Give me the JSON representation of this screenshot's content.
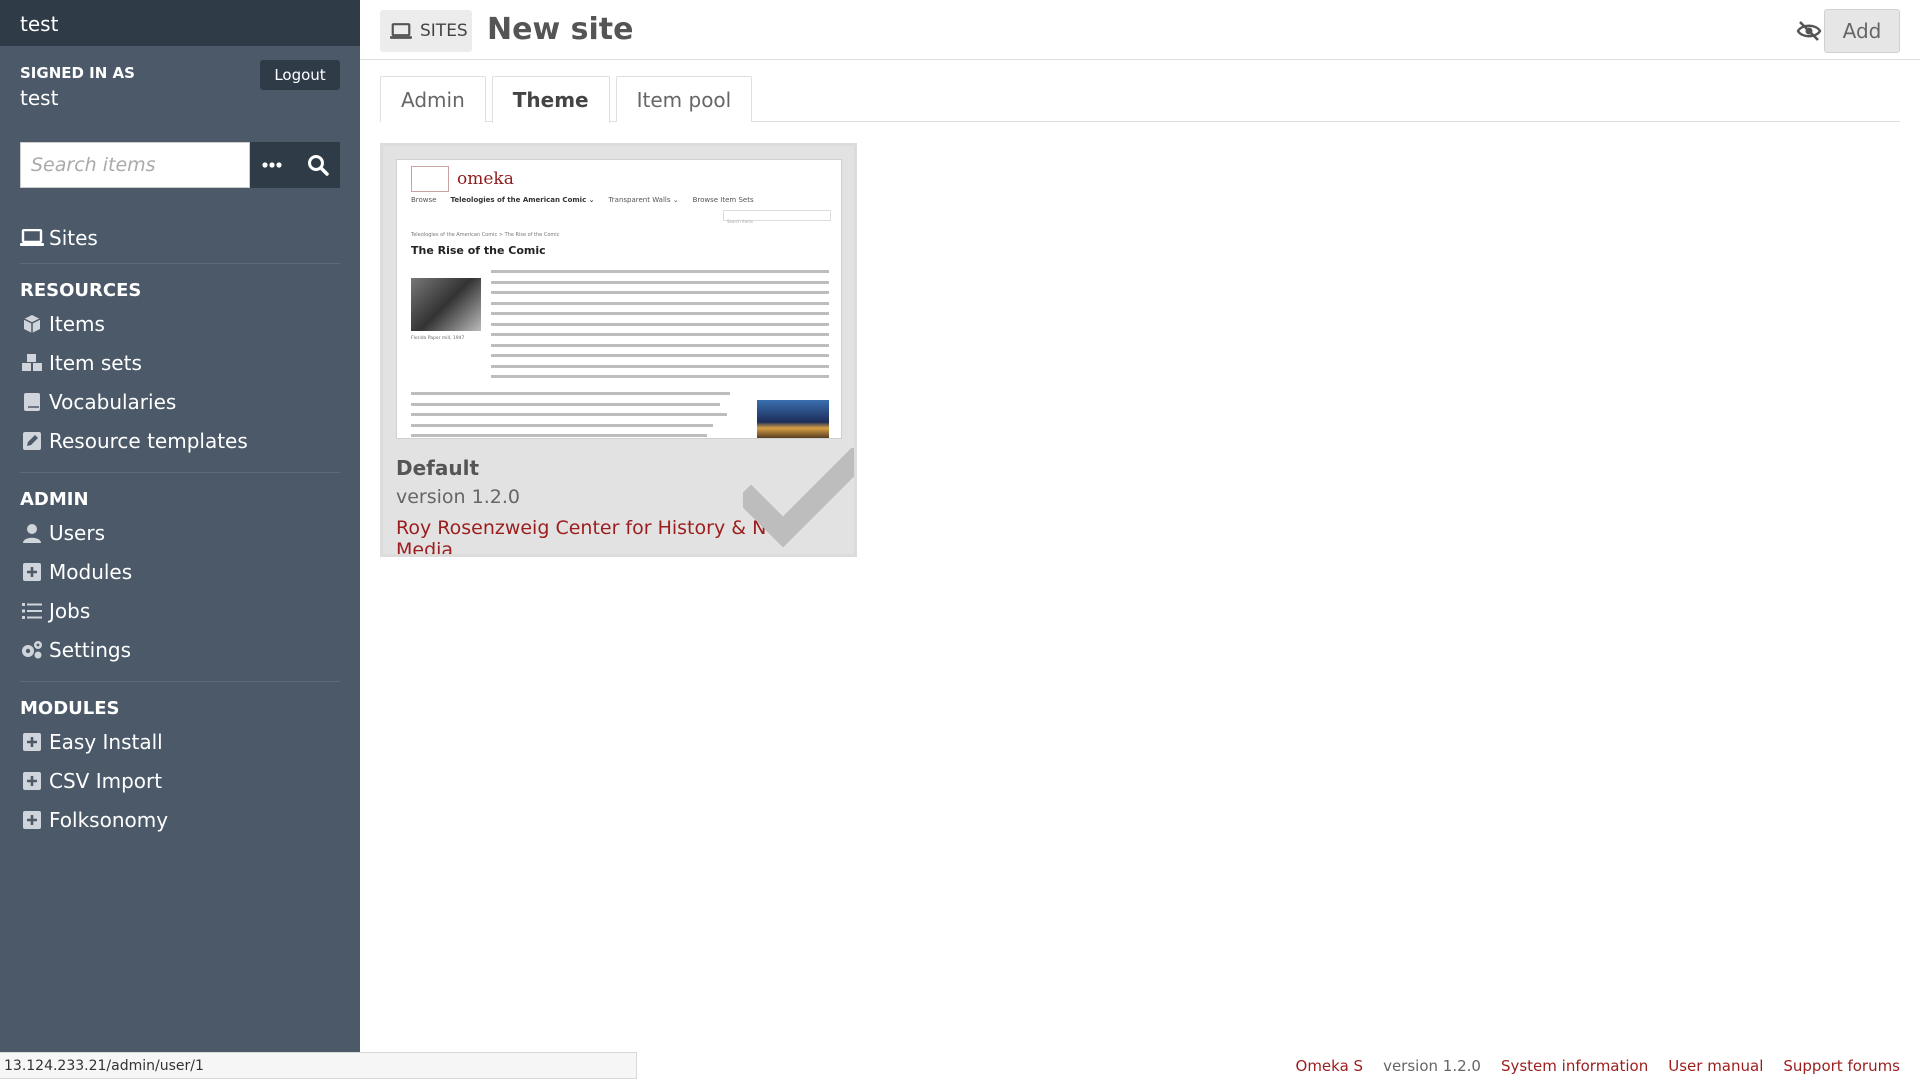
{
  "sidebar": {
    "install_name": "test",
    "signed_in_label": "Signed in as",
    "username": "test",
    "logout_label": "Logout",
    "search_placeholder": "Search items",
    "sites_label": "Sites",
    "resources_heading": "Resources",
    "resources": [
      {
        "label": "Items",
        "icon": "cube-icon"
      },
      {
        "label": "Item sets",
        "icon": "cubes-icon"
      },
      {
        "label": "Vocabularies",
        "icon": "book-icon"
      },
      {
        "label": "Resource templates",
        "icon": "edit-icon"
      }
    ],
    "admin_heading": "Admin",
    "admin": [
      {
        "label": "Users",
        "icon": "user-icon"
      },
      {
        "label": "Modules",
        "icon": "plus-square-icon"
      },
      {
        "label": "Jobs",
        "icon": "list-icon"
      },
      {
        "label": "Settings",
        "icon": "cogs-icon"
      }
    ],
    "modules_heading": "Modules",
    "modules": [
      {
        "label": "Easy Install",
        "icon": "plus-square-icon"
      },
      {
        "label": "CSV Import",
        "icon": "plus-square-icon"
      },
      {
        "label": "Folksonomy",
        "icon": "plus-square-icon"
      }
    ]
  },
  "header": {
    "section_label": "SITES",
    "title": "New site",
    "add_label": "Add"
  },
  "tabs": [
    {
      "label": "Admin",
      "active": false
    },
    {
      "label": "Theme",
      "active": true
    },
    {
      "label": "Item pool",
      "active": false
    }
  ],
  "theme": {
    "name": "Default",
    "version": "version 1.2.0",
    "author": "Roy Rosenzweig Center for History & New Media",
    "preview": {
      "site_name": "omeka",
      "nav": [
        "Browse",
        "Teleologies of the American Comic ⌄",
        "Transparent Walls ⌄",
        "Browse Item Sets"
      ],
      "search_placeholder": "Search items",
      "breadcrumb": "Teleologies of the American Comic > The Rise of the Comic",
      "heading": "The Rise of the Comic",
      "caption": "Florida Paper mill, 1947"
    }
  },
  "footer": {
    "status_url": "13.124.233.21/admin/user/1",
    "omeka_label": "Omeka S",
    "version_label": "version 1.2.0",
    "sysinfo_label": "System information",
    "manual_label": "User manual",
    "forums_label": "Support forums"
  },
  "colors": {
    "sidebar_bg": "#4b5969",
    "sidebar_dark": "#2f3b47",
    "link_red": "#9c1d1d"
  }
}
